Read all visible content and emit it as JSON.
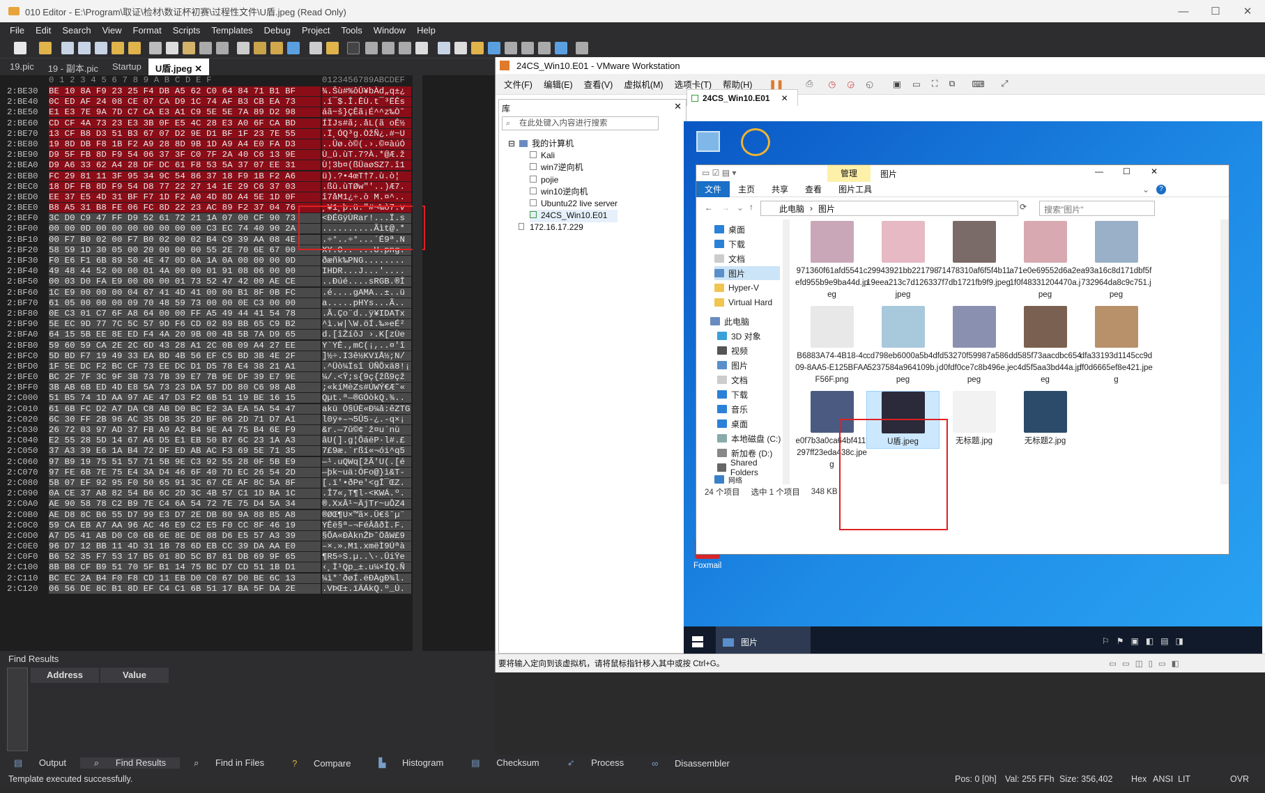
{
  "window": {
    "title": "010 Editor - E:\\Program\\取证\\检材\\数证杯初赛\\过程性文件\\U盾.jpeg (Read Only)",
    "min": "—",
    "max": "☐",
    "close": "✕"
  },
  "menu": [
    "File",
    "Edit",
    "Search",
    "View",
    "Format",
    "Scripts",
    "Templates",
    "Debug",
    "Project",
    "Tools",
    "Window",
    "Help"
  ],
  "tabs": [
    {
      "label": "19.pic"
    },
    {
      "label": "19 - 副本.pic"
    },
    {
      "label": "Startup"
    },
    {
      "label": "U盾.jpeg"
    }
  ],
  "hex": {
    "header_cols": "0  1  2  3  4  5  6  7  8  9  A  B  C  D  E  F",
    "header_ascii": "0123456789ABCDEF",
    "rows": [
      {
        "addr": "2:BE30",
        "bytes": "BE 10 8A F9 23 25 F4 DB A5 62 C0 64 84 71 B1 BF",
        "ascii": "¾.Šù#%ôÛ¥bÀd„q±¿",
        "state": "sel"
      },
      {
        "addr": "2:BE40",
        "bytes": "0C ED AF 24 08 CE 07 CA D9 1C 74 AF B3 CB EA 73",
        "ascii": ".í¯$.Î.ÊÙ.t¯³ËÊs",
        "state": "sel"
      },
      {
        "addr": "2:BE50",
        "bytes": "E1 E3 7E 9A 7D C7 CA E3 A1 C9 5E 5E 7A 89 D2 98",
        "ascii": "áã~š}ÇÊã¡É^^z‰Ò˜",
        "state": "sel"
      },
      {
        "addr": "2:BE60",
        "bytes": "CD CF 4A 73 23 E3 3B 0F E5 4C 28 E3 A0 6F CA BD",
        "ascii": "ÍÏJs#ã;.åL(ã oÊ½",
        "state": "sel"
      },
      {
        "addr": "2:BE70",
        "bytes": "13 CF B8 D3 51 B3 67 07 D2 9E D1 BF 1F 23 7E 55",
        "ascii": ".Ï¸ÓQ³g.ÒžÑ¿.#~U",
        "state": "sel"
      },
      {
        "addr": "2:BE80",
        "bytes": "19 8D DB F8 1B F2 A9 28 8D 9B 1D A9 A4 E0 FA D3",
        "ascii": "..Ûø.ò©(.›.©¤àúÓ",
        "state": "sel"
      },
      {
        "addr": "2:BE90",
        "bytes": "D9 5F FB 8D F9 54 06 37 3F C0 7F 2A 40 C6 13 9E",
        "ascii": "Ù_û.ùT.7?À.*@Æ.ž",
        "state": "sel"
      },
      {
        "addr": "2:BEA0",
        "bytes": "D9 A6 33 62 A4 28 DF DC 61 F8 53 5A 37 07 EE 31",
        "ascii": "Ù¦3b¤(ßÜaøSZ7.î1",
        "state": "sel"
      },
      {
        "addr": "2:BEB0",
        "bytes": "FC 29 81 11 3F 95 34 9C 54 86 37 18 F9 1B F2 A6",
        "ascii": "ü).?•4œT†7.ù.ò¦",
        "state": "sel"
      },
      {
        "addr": "2:BEC0",
        "bytes": "18 DF FB 8D F9 54 D8 77 22 27 14 1E 29 C6 37 03",
        "ascii": ".ßû.ùTØw\"'..)Æ7.",
        "state": "sel"
      },
      {
        "addr": "2:BED0",
        "bytes": "EE 37 E5 4D 31 BF F7 1D F2 A0 4D 8D A4 5E 1D 0F",
        "ascii": "î7åM1¿÷.ò M.¤^..",
        "state": "sel"
      },
      {
        "addr": "2:BEE0",
        "bytes": "B8 A5 31 B8 FE 06 FC 8D 22 23 AC 89 F2 37 04 76",
        "ascii": "¸¥1¸þ.ü.\"#¬‰ò7.v",
        "state": "sel"
      },
      {
        "addr": "2:BEF0",
        "bytes": "3C D0 C9 47 FF D9 52 61 72 21 1A 07 00 CF 90 73",
        "ascii": "<ÐÉGÿÙRar!...Ï.s",
        "state": "gray"
      },
      {
        "addr": "2:BF00",
        "bytes": "00 00 0D 00 00 00 00 00 00 00 C3 EC 74 40 90 2A",
        "ascii": "..........Ãìt@.*",
        "state": "gray"
      },
      {
        "addr": "2:BF10",
        "bytes": "00 F7 B0 02 00 F7 B0 02 00 02 B4 C9 39 AA 08 4E",
        "ascii": ".÷°..÷°...´É9ª.N",
        "state": "gray"
      },
      {
        "addr": "2:BF20",
        "bytes": "58 59 1D 30 05 00 20 00 00 00 55 2E 70 6E 67 00",
        "ascii": "XY.0.. ...U.png.",
        "state": "gray"
      },
      {
        "addr": "2:BF30",
        "bytes": "F0 E6 F1 6B 89 50 4E 47 0D 0A 1A 0A 00 00 00 0D",
        "ascii": "ðæñk‰PNG........",
        "state": "gray"
      },
      {
        "addr": "2:BF40",
        "bytes": "49 48 44 52 00 00 01 4A 00 00 01 91 08 06 00 00",
        "ascii": "IHDR...J...'....",
        "state": "gray"
      },
      {
        "addr": "2:BF50",
        "bytes": "00 03 D0 FA E9 00 00 00 01 73 52 47 42 00 AE CE",
        "ascii": "..Ðúé....sRGB.®Î",
        "state": "gray"
      },
      {
        "addr": "2:BF60",
        "bytes": "1C E9 00 00 00 04 67 41 4D 41 00 00 B1 8F 0B FC",
        "ascii": ".é....gAMA..±..ü",
        "state": "gray"
      },
      {
        "addr": "2:BF70",
        "bytes": "61 05 00 00 00 09 70 48 59 73 00 00 0E C3 00 00",
        "ascii": "a.....pHYs...Ã..",
        "state": "gray"
      },
      {
        "addr": "2:BF80",
        "bytes": "0E C3 01 C7 6F A8 64 00 00 FF A5 49 44 41 54 78",
        "ascii": ".Ã.Ço¨d..ÿ¥IDATx",
        "state": "gray"
      },
      {
        "addr": "2:BF90",
        "bytes": "5E EC 9D 77 7C 5C 57 9D F6 CD 02 89 BB 65 C9 B2",
        "ascii": "^ì.w|\\W.öÍ.‰»eÉ²",
        "state": "gray"
      },
      {
        "addr": "2:BFA0",
        "bytes": "64 15 5B EE 8E ED F4 4A 20 9B 00 4B 5B 7A D9 65",
        "ascii": "d.[îŽíôJ ›.K[zÙe",
        "state": "gray"
      },
      {
        "addr": "2:BFB0",
        "bytes": "59 60 59 CA 2E 2C 6D 43 28 A1 2C 0B 09 A4 27 EE",
        "ascii": "Y`YÊ.,mC(¡,..¤'î",
        "state": "gray"
      },
      {
        "addr": "2:BFC0",
        "bytes": "5D BD F7 19 49 33 EA BD 4B 56 EF C5 BD 3B 4E 2F",
        "ascii": "]½÷.I3ê½KVïÅ½;N/",
        "state": "gray"
      },
      {
        "addr": "2:BFD0",
        "bytes": "1F 5E DC F2 BC CF 73 EE DC D1 D5 78 E4 38 21 A1",
        "ascii": ".^Üò¼Ïsî ÜÑÕxä8!¡",
        "state": "gray"
      },
      {
        "addr": "2:BFE0",
        "bytes": "BC 2F 7F 3C 9F 3B 73 7B 39 E7 7B 9E DF 39 E7 9E",
        "ascii": "¼/.<Ÿ;s{9ç{žß9çž",
        "state": "gray"
      },
      {
        "addr": "2:BFF0",
        "bytes": "3B AB 6B ED 4D E8 5A 73 23 DA 57 DD 80 C6 98 AB",
        "ascii": ";«kíMèZs#ÚWÝ€Æ˜«",
        "state": "gray"
      },
      {
        "addr": "2:C000",
        "bytes": "51 B5 74 1D AA 97 AE 47 D3 F2 6B 51 19 BE 16 15",
        "ascii": "Qµt.ª—®GÓòkQ.¾..",
        "state": "gray"
      },
      {
        "addr": "2:C010",
        "bytes": "61 6B FC D2 A7 DA C8 AB D0 BC E2 3A EA 5A 54 47",
        "ascii": "akü Ò§ÚÈ«Ð¼â:êZTG",
        "state": "gray"
      },
      {
        "addr": "2:C020",
        "bytes": "6C 30 FF 2B 96 AC 35 DB 35 2D BF 06 2D 71 D7 A1",
        "ascii": "l0ÿ+–¬5Û5-¿.-q×¡",
        "state": "gray"
      },
      {
        "addr": "2:C030",
        "bytes": "26 72 03 97 AD 37 FB A9 A2 B4 9E A4 75 B4 6E F9",
        "ascii": "&r.—­7û©¢´ž¤u´nù",
        "state": "gray"
      },
      {
        "addr": "2:C040",
        "bytes": "E2 55 28 5D 14 67 A6 D5 E1 EB 50 B7 6C 23 1A A3",
        "ascii": "âU(].g¦ÕáëP·l#.£",
        "state": "gray"
      },
      {
        "addr": "2:C050",
        "bytes": "37 A3 39 E6 1A B4 72 DF ED AB AC F3 69 5E 71 35",
        "ascii": "7£9æ.´rßí«¬ói^q5",
        "state": "gray"
      },
      {
        "addr": "2:C060",
        "bytes": "97 B9 19 75 51 57 71 5B 9E C3 92 55 28 0F 5B E9",
        "ascii": "—¹.uQWq[žÃ'U(.[é",
        "state": "gray"
      },
      {
        "addr": "2:C070",
        "bytes": "97 FE 6B 7E 75 E4 3A D4 46 6F 40 7D EC 26 54 2D",
        "ascii": "—þk~uä:ÔFo@}ì&T-",
        "state": "gray"
      },
      {
        "addr": "2:C080",
        "bytes": "5B 07 EF 92 95 F0 50 65 91 3C 67 CE AF 8C 5A 8F",
        "ascii": "[.ï'•ðPe'<gÎ¯ŒZ.",
        "state": "gray"
      },
      {
        "addr": "2:C090",
        "bytes": "0A CE 37 AB 82 54 B6 6C 2D 3C 4B 57 C1 1D BA 1C",
        "ascii": ".Î7«‚T¶l-<KWÁ.º.",
        "state": "gray"
      },
      {
        "addr": "2:C0A0",
        "bytes": "AE 90 58 78 C2 B9 7E C4 6A 54 72 7E 75 D4 5A 34",
        "ascii": "®.XxÂ¹~ÄjTr~uÔZ4",
        "state": "gray"
      },
      {
        "addr": "2:C0B0",
        "bytes": "AE D8 8C B6 55 D7 99 E3 D7 2E DB 80 9A 88 B5 A8",
        "ascii": "®ØŒ¶U×™ã×.Û€šˆµ¨",
        "state": "gray"
      },
      {
        "addr": "2:C0C0",
        "bytes": "59 CA EB A7 AA 96 AC 46 E9 C2 E5 F0 CC 8F 46 19",
        "ascii": "YÊë§ª–¬FéÂåðÌ.F.",
        "state": "gray"
      },
      {
        "addr": "2:C0D0",
        "bytes": "A7 D5 41 AB D0 C0 6B 6E 8E DE 88 D6 E5 57 A3 39",
        "ascii": "§ÕA«ÐÀknŽÞˆÖåW£9",
        "state": "gray"
      },
      {
        "addr": "2:C0E0",
        "bytes": "96 D7 12 BB 11 4D 31 1B 78 6D EB CC 39 DA AA E0",
        "ascii": "–×.».M1.xmëÌ9Úªà",
        "state": "gray"
      },
      {
        "addr": "2:C0F0",
        "bytes": "B6 52 35 F7 53 17 B5 01 8D 5C B7 81 DB 69 9F 65",
        "ascii": "¶R5÷S.µ..\\·.ÛiŸe",
        "state": "gray"
      },
      {
        "addr": "2:C100",
        "bytes": "8B B8 CF B9 51 70 5F B1 14 75 BC D7 CD 51 1B D1",
        "ascii": "‹¸Ï¹Qp_±.u¼×ÍQ.Ñ",
        "state": "gray"
      },
      {
        "addr": "2:C110",
        "bytes": "BC EC 2A B4 F0 F8 CD 11 EB D0 C0 67 D0 BE 6C 13",
        "ascii": "¼ì*´ðøÍ.ëÐÀgÐ¾l.",
        "state": "gray"
      },
      {
        "addr": "2:C120",
        "bytes": "06 56 DE 8C B1 8D EF C4 C1 6B 51 17 BA 5F DA 2E",
        "ascii": ".VÞŒ±.ïÄÁkQ.º_Ú.",
        "state": "gray"
      }
    ]
  },
  "find_results": {
    "title": "Find Results",
    "col_address": "Address",
    "col_value": "Value"
  },
  "bottom_tabs": [
    "Output",
    "Find Results",
    "Find in Files",
    "Compare",
    "Histogram",
    "Checksum",
    "Process",
    "Disassembler"
  ],
  "status": {
    "left": "Template executed successfully.",
    "pos": "Pos: 0 [0h]",
    "val": "Val: 255 FFh",
    "size": "Size: 356,402",
    "hex": "Hex",
    "ansi": "ANSI",
    "lit": "LIT",
    "ovr": "OVR"
  },
  "vmware": {
    "title": "24CS_Win10.E01 - VMware Workstation",
    "menu": [
      "文件(F)",
      "编辑(E)",
      "查看(V)",
      "虚拟机(M)",
      "选项卡(T)",
      "帮助(H)"
    ],
    "library_title": "库",
    "search_placeholder": "在此处键入内容进行搜索",
    "tree_root": "我的计算机",
    "tree_items": [
      "Kali",
      "win7逆向机",
      "pojie",
      "win10逆向机",
      "Ubuntu22 live server",
      "24CS_Win10.E01"
    ],
    "tree_remote": "172.16.17.229",
    "vm_tab": "24CS_Win10.E01",
    "status_hint": "要将输入定向到该虚拟机，请将鼠标指针移入其中或按 Ctrl+G。"
  },
  "explorer": {
    "ribbon_manage": "管理",
    "ribbon_title": "图片",
    "ribbon_tabs": [
      "文件",
      "主页",
      "共享",
      "查看",
      "图片工具"
    ],
    "path": [
      "此电脑",
      "图片"
    ],
    "search_placeholder": "搜索\"图片\"",
    "nav_quick": [
      "桌面",
      "下载",
      "文档",
      "图片",
      "Hyper-V",
      "Virtual Hard"
    ],
    "nav_pc": "此电脑",
    "nav_pc_items": [
      "3D 对象",
      "视频",
      "图片",
      "文档",
      "下载",
      "音乐",
      "桌面",
      "本地磁盘 (C:)",
      "新加卷 (D:)",
      "Shared Folders"
    ],
    "nav_net": "网络",
    "files": [
      "971360f61afd5541cefd955b9e9ba44d.jpeg",
      "29943921bb22179819eea213c7d12633.jpeg",
      "71478310af6f5f4b117f7db1721fb9f9.jpeg",
      "a71e0e69552d6a2e1f0f48331204470a.jpeg",
      "a93a16c8d171dbf5f732964da8c9c751.jpeg",
      "B6883A74-4B18-4c09-8AA5-E125BFAAF56F.png",
      "cd798eb6000a5b4df5237584a964109b.jpeg",
      "d53270f59987a586d0fdf0ce7c8b496e.jpeg",
      "dd585f73aacdbc654ec4d5f5aa3bd44a.jpeg",
      "dfa33193d1145cc9dff0d6665ef8e421.jpeg",
      "e0f7b3a0ca64bf411f297ff23eda438c.jpeg",
      "U盾.jpeg",
      "无标题.jpg",
      "无标题2.jpg"
    ],
    "status_count": "24 个项目",
    "status_selected": "选中 1 个项目",
    "status_size": "348 KB"
  },
  "desktop": {
    "foxmail_label": "Foxmail",
    "taskbar_item": "图片"
  },
  "colors": {
    "selection": "#8b0d18",
    "annotation": "#e02020",
    "desktop": "#1e8be6"
  }
}
